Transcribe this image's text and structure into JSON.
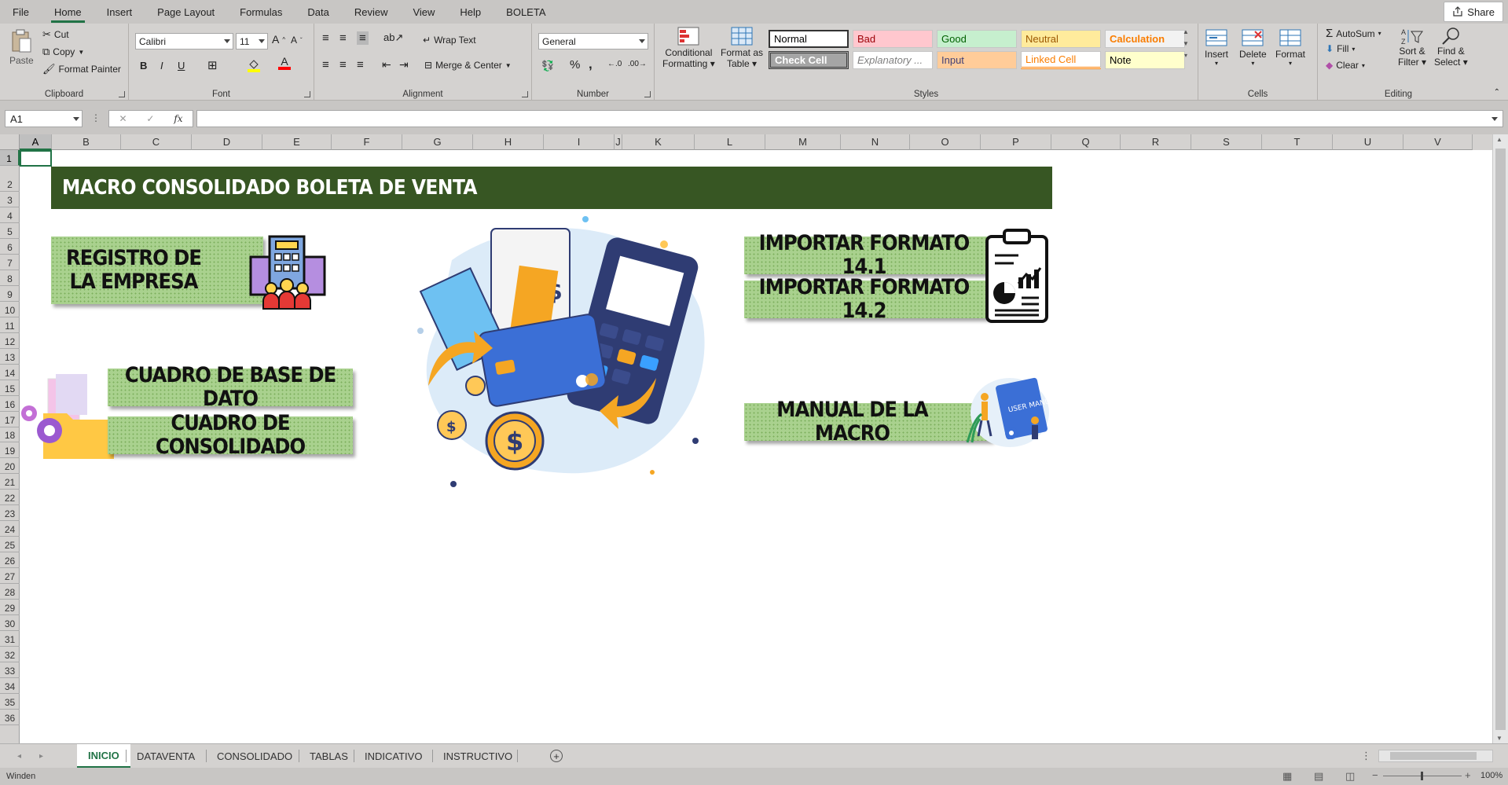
{
  "ribbon_tabs": [
    "File",
    "Home",
    "Insert",
    "Page Layout",
    "Formulas",
    "Data",
    "Review",
    "View",
    "Help",
    "BOLETA"
  ],
  "share_label": "Share",
  "clipboard": {
    "paste": "Paste",
    "cut": "Cut",
    "copy": "Copy",
    "format_painter": "Format Painter",
    "label": "Clipboard"
  },
  "font": {
    "name": "Calibri",
    "size": "11",
    "label": "Font",
    "bold": "B",
    "italic": "I",
    "underline": "U",
    "color_letter": "A"
  },
  "alignment": {
    "wrap_text": "Wrap Text",
    "merge_center": "Merge & Center",
    "label": "Alignment"
  },
  "number": {
    "format": "General",
    "label": "Number",
    "percent": "%",
    "comma": ","
  },
  "styles": {
    "conditional": "Conditional",
    "conditional2": "Formatting",
    "format_table": "Format as",
    "format_table2": "Table",
    "label": "Styles",
    "cells": [
      {
        "name": "Normal",
        "bg": "#ffffff",
        "color": "#000000"
      },
      {
        "name": "Bad",
        "bg": "#ffc7ce",
        "color": "#9c0006"
      },
      {
        "name": "Good",
        "bg": "#c6efce",
        "color": "#006100"
      },
      {
        "name": "Neutral",
        "bg": "#ffeb9c",
        "color": "#9c5700"
      },
      {
        "name": "Calculation",
        "bg": "#f2f2f2",
        "color": "#fa7d00"
      },
      {
        "name": "Check Cell",
        "bg": "#a5a5a5",
        "color": "#ffffff"
      },
      {
        "name": "Explanatory ...",
        "bg": "#ffffff",
        "color": "#7f7f7f"
      },
      {
        "name": "Input",
        "bg": "#ffcc99",
        "color": "#3f3f76"
      },
      {
        "name": "Linked Cell",
        "bg": "#ffffff",
        "color": "#fa7d00"
      },
      {
        "name": "Note",
        "bg": "#ffffcc",
        "color": "#000000"
      }
    ]
  },
  "cells_group": {
    "insert": "Insert",
    "delete": "Delete",
    "format": "Format",
    "label": "Cells"
  },
  "editing": {
    "autosum": "AutoSum",
    "fill": "Fill",
    "clear": "Clear",
    "sort": "Sort &",
    "sort2": "Filter",
    "find": "Find &",
    "find2": "Select",
    "label": "Editing"
  },
  "name_box": "A1",
  "fx": "fx",
  "columns": [
    "A",
    "B",
    "C",
    "D",
    "E",
    "F",
    "G",
    "H",
    "I",
    "J",
    "K",
    "L",
    "M",
    "N",
    "O",
    "P",
    "Q",
    "R",
    "S",
    "T",
    "U",
    "V"
  ],
  "rows": [
    "1",
    "2",
    "3",
    "4",
    "5",
    "6",
    "7",
    "8",
    "9",
    "10",
    "11",
    "12",
    "13",
    "14",
    "15",
    "16",
    "17",
    "18",
    "19",
    "20",
    "21",
    "22",
    "23",
    "24",
    "25",
    "26",
    "27",
    "28",
    "29",
    "30",
    "31",
    "32",
    "33",
    "34",
    "35",
    "36"
  ],
  "title": "MACRO CONSOLIDADO BOLETA DE VENTA",
  "buttons": {
    "registro": "REGISTRO DE LA EMPRESA",
    "formato141": "IMPORTAR FORMATO 14.1",
    "formato142": "IMPORTAR FORMATO 14.2",
    "base_dato": "CUADRO DE BASE DE DATO",
    "consolidado": "CUADRO DE CONSOLIDADO",
    "manual": "MANUAL DE LA MACRO",
    "user_manual": "USER MANUAL"
  },
  "sheet_tabs": [
    "INICIO",
    "DATAVENTA",
    "CONSOLIDADO",
    "TABLAS",
    "INDICATIVO",
    "INSTRUCTIVO"
  ],
  "status": "Winden",
  "zoom": "100%",
  "accent": "#217346",
  "title_bg": "#375623",
  "button_bg": "#a9d18e"
}
